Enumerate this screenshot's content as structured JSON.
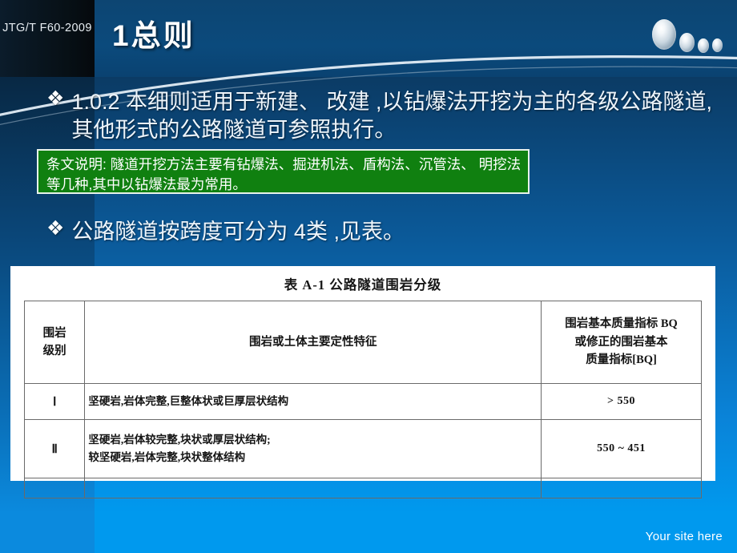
{
  "header": {
    "doc_code": "JTG/T F60-2009",
    "title": "1总则"
  },
  "decor": {
    "bubble_count": 4,
    "arc_color": "#dfe9f2",
    "accent_blue": "#0b4a7c",
    "bottom_blue": "#0099ee",
    "note_green": "#108010"
  },
  "body": {
    "bullet_symbol": "❖",
    "bullet1": "1.0.2  本细则适用于新建、 改建 ,以钻爆法开挖为主的各级公路隧道,其他形式的公路隧道可参照执行。",
    "note": "条文说明: 隧道开挖方法主要有钻爆法、掘进机法、盾构法、沉管法、 明挖法等几种,其中以钻爆法最为常用。",
    "bullet2": "公路隧道按跨度可分为 4类 ,见表。"
  },
  "table": {
    "caption": "表 A-1    公路隧道围岩分级",
    "headers": {
      "col1": "围岩\n级别",
      "col1_line1": "围岩",
      "col1_line2": "级别",
      "col2": "围岩或土体主要定性特征",
      "col3_line1": "围岩基本质量指标 BQ",
      "col3_line2": "或修正的围岩基本",
      "col3_line3": "质量指标[BQ]"
    },
    "rows": [
      {
        "grade": "Ⅰ",
        "desc_line1": "坚硬岩,岩体完整,巨整体状或巨厚层状结构",
        "desc_line2": "",
        "bq": "> 550"
      },
      {
        "grade": "Ⅱ",
        "desc_line1": "坚硬岩,岩体较完整,块状或厚层状结构;",
        "desc_line2": "较坚硬岩,岩体完整,块状整体结构",
        "bq": "550 ~ 451"
      }
    ]
  },
  "footer": {
    "text": "Your site here"
  }
}
